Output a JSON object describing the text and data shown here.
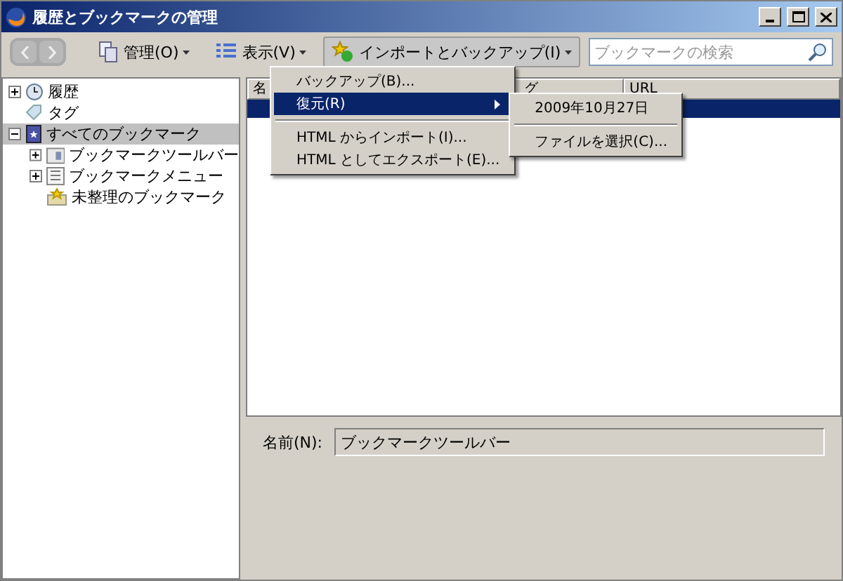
{
  "window": {
    "title": "履歴とブックマークの管理"
  },
  "toolbar": {
    "buttons": [
      {
        "label": "管理(O)",
        "kind": "organize"
      },
      {
        "label": "表示(V)",
        "kind": "views"
      },
      {
        "label": "インポートとバックアップ(I)",
        "kind": "import",
        "selected": true
      }
    ],
    "search": {
      "placeholder": "ブックマークの検索"
    }
  },
  "sidebar": {
    "items": [
      {
        "label": "履歴",
        "kind": "history",
        "expanded": false,
        "selected": false
      },
      {
        "label": "タグ",
        "kind": "tag",
        "selected": false
      },
      {
        "label": "すべてのブックマーク",
        "kind": "all",
        "expanded": true,
        "selected": true,
        "children": [
          {
            "label": "ブックマークツールバー",
            "kind": "toolbar",
            "expanded": false,
            "selected": false
          },
          {
            "label": "ブックマークメニュー",
            "kind": "menu",
            "expanded": false,
            "selected": false
          },
          {
            "label": "未整理のブックマーク",
            "kind": "unsorted",
            "selected": false
          }
        ]
      }
    ]
  },
  "table": {
    "columns": [
      "名",
      "グ",
      "URL"
    ],
    "rows": [
      {
        "selected": true
      }
    ]
  },
  "menu": {
    "items": [
      {
        "label": "バックアップ(B)...",
        "kind": "item",
        "selected": false
      },
      {
        "label": "復元(R)",
        "kind": "submenu",
        "selected": true
      },
      {
        "kind": "separator"
      },
      {
        "label": "HTML からインポート(I)...",
        "kind": "item",
        "selected": false
      },
      {
        "label": "HTML としてエクスポート(E)...",
        "kind": "item",
        "selected": false
      }
    ],
    "submenu": [
      {
        "label": "2009年10月27日",
        "kind": "item",
        "selected": false
      },
      {
        "kind": "separator"
      },
      {
        "label": "ファイルを選択(C)...",
        "kind": "item",
        "selected": false
      }
    ]
  },
  "details": {
    "name_label": "名前(N):",
    "name_value": "ブックマークツールバー"
  }
}
